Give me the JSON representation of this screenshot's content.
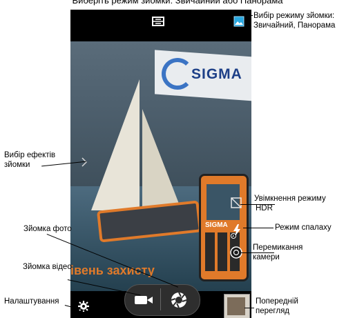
{
  "document": {
    "title": "Виберіть режим зйомки: Звичайний або Панорама"
  },
  "callouts": {
    "shooting_mode": {
      "line1": "Вибір режиму зйомки:",
      "line2": "Звичайний, Панорама"
    },
    "effects": {
      "line1": "Вибір ефектів",
      "line2": "зйомки"
    },
    "hdr": {
      "line1": "Увімкнення режиму",
      "line2": "HDR"
    },
    "flash": {
      "line1": "Режим спалаху"
    },
    "switch_camera": {
      "line1": "Перемикання",
      "line2": "камери"
    },
    "photo": {
      "line1": "Зйомка фото"
    },
    "video": {
      "line1": "Зйомка відео"
    },
    "settings": {
      "line1": "Налаштування"
    },
    "preview": {
      "line1": "Попередній",
      "line2": "перегляд"
    }
  },
  "viewfinder": {
    "banner_text": "SIGMA",
    "phone_logo": "SIGMA",
    "sea_text": "івень захисту"
  },
  "icons": {
    "top_left": "panorama-mode-icon",
    "top_right": "normal-mode-icon",
    "effects": "chevron-right-icon",
    "hdr": "hdr-icon",
    "flash": "flash-auto-icon",
    "switch": "switch-camera-icon",
    "video": "video-camera-icon",
    "shutter": "camera-shutter-icon",
    "settings": "gear-icon"
  },
  "colors": {
    "accent_blue": "#29a8e0",
    "phone_body": "#e07a2a"
  }
}
